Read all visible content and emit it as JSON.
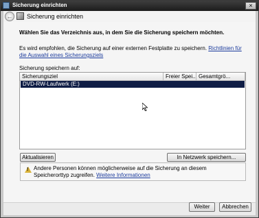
{
  "window": {
    "title": "Sicherung einrichten",
    "close_glyph": "×"
  },
  "header": {
    "title": "Sicherung einrichten",
    "back_glyph": "←"
  },
  "main": {
    "heading": "Wählen Sie das Verzeichnis aus, in dem Sie die Sicherung speichern möchten.",
    "intro_text": "Es wird empfohlen, die Sicherung auf einer externen Festplatte zu speichern.",
    "intro_link": "Richtlinien für die Auswahl eines Sicherungsziels",
    "list_label": "Sicherung speichern auf:",
    "columns": [
      "Sicherungsziel",
      "Freier Spei...",
      "Gesamtgrö..."
    ],
    "rows": [
      {
        "name": "DVD-RW-Laufwerk (E:)",
        "selected": true
      }
    ],
    "refresh_label": "Aktualisieren",
    "network_label": "In Netzwerk speichern...",
    "warning_text": "Andere Personen können möglicherweise auf die Sicherung an diesem Speicherorttyp zugreifen.",
    "warning_link": "Weitere Informationen",
    "warning_icon": "warning-icon"
  },
  "footer": {
    "next_label": "Weiter",
    "cancel_label": "Abbrechen"
  },
  "colors": {
    "selection": "#0f1d45",
    "link": "#1a3a9c",
    "titlebar": "#2a2a2a"
  }
}
